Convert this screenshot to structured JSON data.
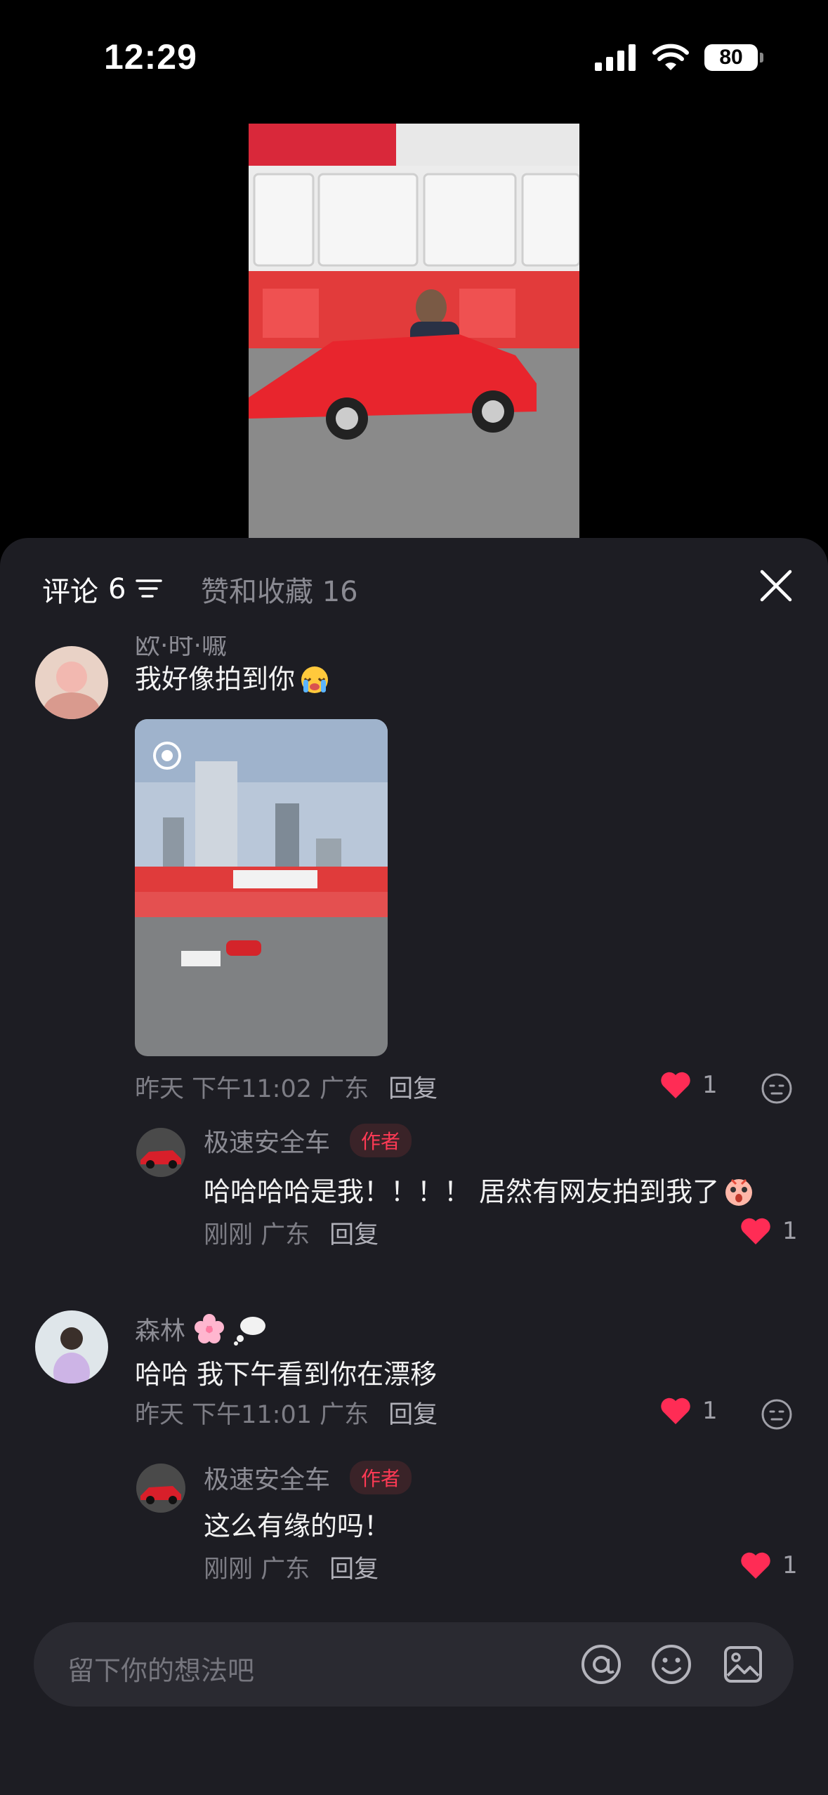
{
  "status_bar": {
    "time": "12:29",
    "battery": "80"
  },
  "sheet": {
    "tabs": {
      "comments_label": "评论",
      "comments_count": "6",
      "likes_label": "赞和收藏 16"
    }
  },
  "comments": [
    {
      "name": "欧·时·嘁",
      "text": "我好像拍到你",
      "meta": "昨天 下午11:02 广东",
      "reply": "回复",
      "likes": "1",
      "replies": [
        {
          "name": "极速安全车",
          "tag": "作者",
          "text": "哈哈哈哈是我！！！！ 居然有网友拍到我了",
          "meta": "刚刚 广东",
          "reply": "回复",
          "likes": "1"
        }
      ]
    },
    {
      "name": "森林",
      "text": "哈哈 我下午看到你在漂移",
      "meta": "昨天 下午11:01 广东",
      "reply": "回复",
      "likes": "1",
      "replies": [
        {
          "name": "极速安全车",
          "tag": "作者",
          "text": "这么有缘的吗！",
          "meta": "刚刚 广东",
          "reply": "回复",
          "likes": "1"
        }
      ]
    }
  ],
  "input": {
    "placeholder": "留下你的想法吧"
  },
  "colors": {
    "accent_red": "#ff2c55",
    "sheet_bg": "#1d1d23"
  }
}
